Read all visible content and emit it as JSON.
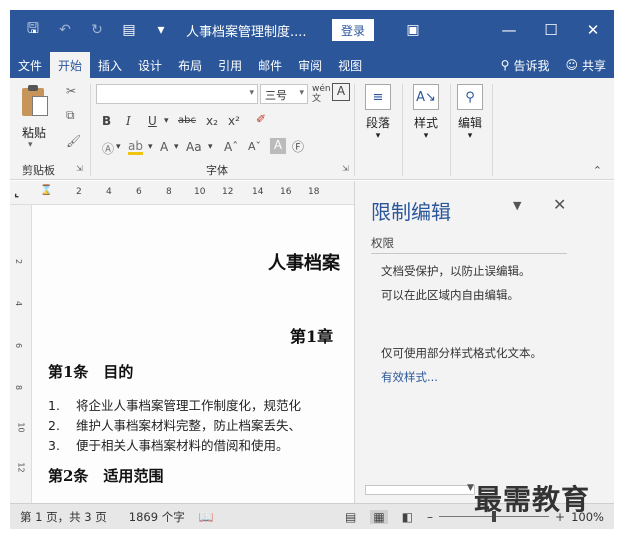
{
  "titlebar": {
    "doc_title": "人事档案管理制度....",
    "login_label": "登录",
    "icons": [
      "save-icon",
      "undo-icon",
      "redo-icon",
      "touch-mode-icon",
      "customize-qat-icon"
    ]
  },
  "tabs": [
    {
      "label": "文件"
    },
    {
      "label": "开始"
    },
    {
      "label": "插入"
    },
    {
      "label": "设计"
    },
    {
      "label": "布局"
    },
    {
      "label": "引用"
    },
    {
      "label": "邮件"
    },
    {
      "label": "审阅"
    },
    {
      "label": "视图"
    }
  ],
  "tab_extra": {
    "tell_me": "告诉我",
    "share": "共享"
  },
  "ribbon": {
    "paste_label": "粘贴",
    "clipboard_group": "剪贴板",
    "font_group": "字体",
    "font_size_value": "三号",
    "wen_label": "wén 文",
    "paragraph_label": "段落",
    "styles_label": "样式",
    "editing_label": "编辑"
  },
  "document": {
    "heading1": "人事档案",
    "heading2": "第1章",
    "article1": "第1条　目的",
    "list": [
      {
        "num": "1.",
        "text": "将企业人事档案管理工作制度化，规范化"
      },
      {
        "num": "2.",
        "text": "维护人事档案材料完整，防止档案丢失、"
      },
      {
        "num": "3.",
        "text": "便于相关人事档案材料的借阅和使用。"
      }
    ],
    "article2": "第2条　适用范围"
  },
  "ruler": {
    "h_ticks": [
      "2",
      "4",
      "6",
      "8",
      "10",
      "12",
      "14",
      "16",
      "18"
    ],
    "v_ticks": [
      "2",
      "4",
      "6",
      "8",
      "10",
      "12"
    ]
  },
  "pane": {
    "title": "限制编辑",
    "section": "权限",
    "line1": "文档受保护，以防止误编辑。",
    "line2": "可以在此区域内自由编辑。",
    "line3": "仅可使用部分样式格式化文本。",
    "link": "有效样式..."
  },
  "status": {
    "page": "第 1 页，共 3 页",
    "words": "1869 个字",
    "zoom": "100%",
    "zoom_fraction": 0.5
  },
  "watermark": "最需教育",
  "colors": {
    "accent": "#2b579a",
    "ribbon_bg": "#f3f3f3"
  }
}
